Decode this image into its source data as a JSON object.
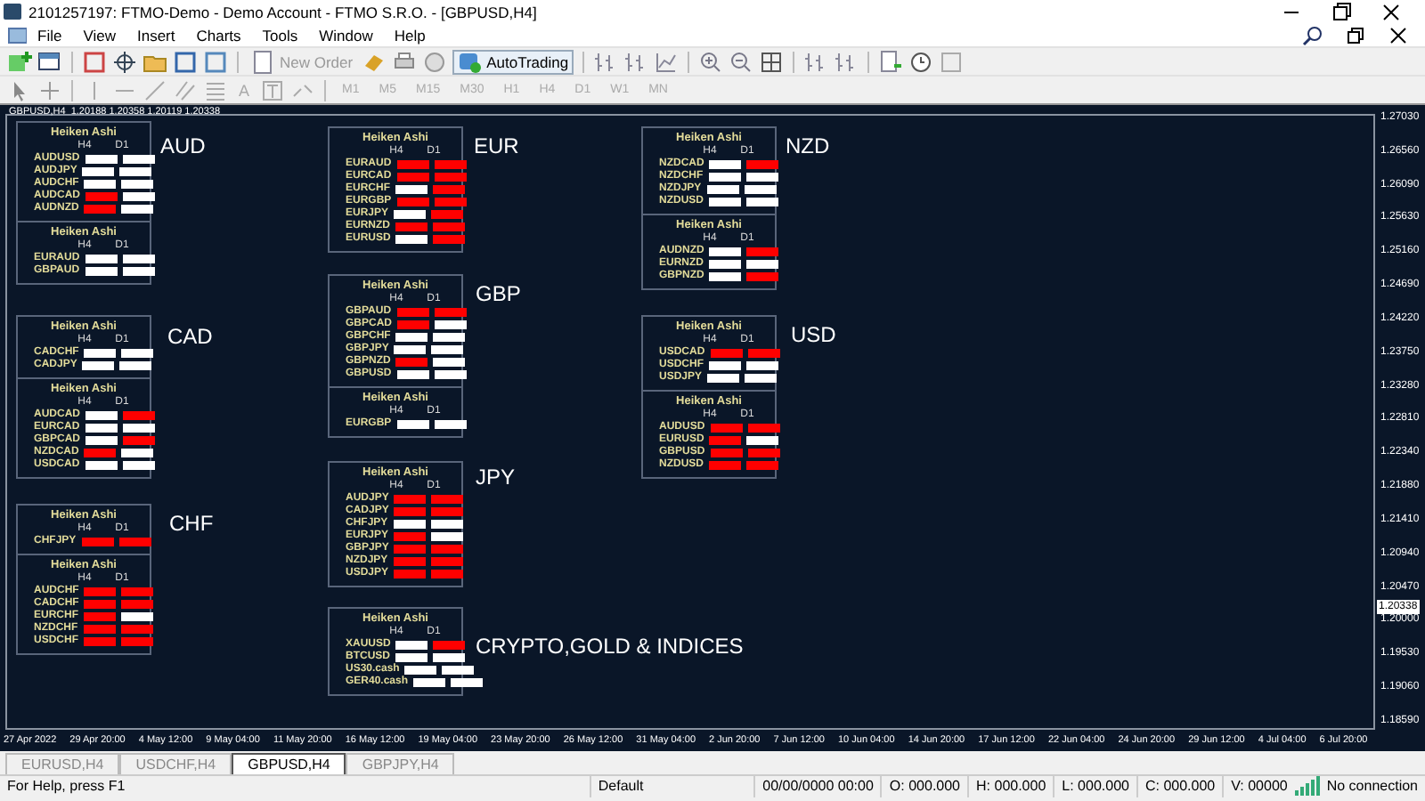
{
  "window": {
    "title": "2101257197: FTMO-Demo - Demo Account - FTMO S.R.O. - [GBPUSD,H4]"
  },
  "menu": [
    "File",
    "View",
    "Insert",
    "Charts",
    "Tools",
    "Window",
    "Help"
  ],
  "toolbar": {
    "new_order": "New Order",
    "auto_trading": "AutoTrading",
    "timeframes": [
      "M1",
      "M5",
      "M15",
      "M30",
      "H1",
      "H4",
      "D1",
      "W1",
      "MN"
    ],
    "text_tool": "A"
  },
  "chart": {
    "header": "GBPUSD,H4  1.20188 1.20358 1.20119 1.20338",
    "groups": [
      {
        "currency": "AUD",
        "panels": [
          {
            "title": "Heiken Ashi",
            "columns": [
              "H4",
              "D1"
            ],
            "rows": [
              {
                "pair": "AUDUSD",
                "h4_down": false,
                "d1_down": false
              },
              {
                "pair": "AUDJPY",
                "h4_down": false,
                "d1_down": false
              },
              {
                "pair": "AUDCHF",
                "h4_down": false,
                "d1_down": false
              },
              {
                "pair": "AUDCAD",
                "h4_down": true,
                "d1_down": false
              },
              {
                "pair": "AUDNZD",
                "h4_down": true,
                "d1_down": false
              }
            ]
          },
          {
            "title": "Heiken Ashi",
            "columns": [
              "H4",
              "D1"
            ],
            "rows": [
              {
                "pair": "EURAUD",
                "h4_down": false,
                "d1_down": false
              },
              {
                "pair": "GBPAUD",
                "h4_down": false,
                "d1_down": false
              }
            ]
          }
        ]
      },
      {
        "currency": "CAD",
        "panels": [
          {
            "title": "Heiken Ashi",
            "columns": [
              "H4",
              "D1"
            ],
            "rows": [
              {
                "pair": "CADCHF",
                "h4_down": false,
                "d1_down": false
              },
              {
                "pair": "CADJPY",
                "h4_down": false,
                "d1_down": false
              }
            ]
          },
          {
            "title": "Heiken Ashi",
            "columns": [
              "H4",
              "D1"
            ],
            "rows": [
              {
                "pair": "AUDCAD",
                "h4_down": false,
                "d1_down": true
              },
              {
                "pair": "EURCAD",
                "h4_down": false,
                "d1_down": false
              },
              {
                "pair": "GBPCAD",
                "h4_down": false,
                "d1_down": true
              },
              {
                "pair": "NZDCAD",
                "h4_down": true,
                "d1_down": false
              },
              {
                "pair": "USDCAD",
                "h4_down": false,
                "d1_down": false
              }
            ]
          }
        ]
      },
      {
        "currency": "CHF",
        "panels": [
          {
            "title": "Heiken Ashi",
            "columns": [
              "H4",
              "D1"
            ],
            "rows": [
              {
                "pair": "CHFJPY",
                "h4_down": true,
                "d1_down": true
              }
            ]
          },
          {
            "title": "Heiken Ashi",
            "columns": [
              "H4",
              "D1"
            ],
            "rows": [
              {
                "pair": "AUDCHF",
                "h4_down": true,
                "d1_down": true
              },
              {
                "pair": "CADCHF",
                "h4_down": true,
                "d1_down": true
              },
              {
                "pair": "EURCHF",
                "h4_down": true,
                "d1_down": false
              },
              {
                "pair": "NZDCHF",
                "h4_down": true,
                "d1_down": true
              },
              {
                "pair": "USDCHF",
                "h4_down": true,
                "d1_down": true
              }
            ]
          }
        ]
      },
      {
        "currency": "EUR",
        "panels": [
          {
            "title": "Heiken Ashi",
            "columns": [
              "H4",
              "D1"
            ],
            "rows": [
              {
                "pair": "EURAUD",
                "h4_down": true,
                "d1_down": true
              },
              {
                "pair": "EURCAD",
                "h4_down": true,
                "d1_down": true
              },
              {
                "pair": "EURCHF",
                "h4_down": false,
                "d1_down": true
              },
              {
                "pair": "EURGBP",
                "h4_down": true,
                "d1_down": true
              },
              {
                "pair": "EURJPY",
                "h4_down": false,
                "d1_down": true
              },
              {
                "pair": "EURNZD",
                "h4_down": true,
                "d1_down": true
              },
              {
                "pair": "EURUSD",
                "h4_down": false,
                "d1_down": true
              }
            ]
          }
        ]
      },
      {
        "currency": "GBP",
        "panels": [
          {
            "title": "Heiken Ashi",
            "columns": [
              "H4",
              "D1"
            ],
            "rows": [
              {
                "pair": "GBPAUD",
                "h4_down": true,
                "d1_down": true
              },
              {
                "pair": "GBPCAD",
                "h4_down": true,
                "d1_down": false
              },
              {
                "pair": "GBPCHF",
                "h4_down": false,
                "d1_down": false
              },
              {
                "pair": "GBPJPY",
                "h4_down": false,
                "d1_down": false
              },
              {
                "pair": "GBPNZD",
                "h4_down": true,
                "d1_down": false
              },
              {
                "pair": "GBPUSD",
                "h4_down": false,
                "d1_down": false
              }
            ]
          },
          {
            "title": "Heiken Ashi",
            "columns": [
              "H4",
              "D1"
            ],
            "rows": [
              {
                "pair": "EURGBP",
                "h4_down": false,
                "d1_down": false
              }
            ]
          }
        ]
      },
      {
        "currency": "JPY",
        "panels": [
          {
            "title": "Heiken Ashi",
            "columns": [
              "H4",
              "D1"
            ],
            "rows": [
              {
                "pair": "AUDJPY",
                "h4_down": true,
                "d1_down": true
              },
              {
                "pair": "CADJPY",
                "h4_down": true,
                "d1_down": true
              },
              {
                "pair": "CHFJPY",
                "h4_down": false,
                "d1_down": false
              },
              {
                "pair": "EURJPY",
                "h4_down": true,
                "d1_down": false
              },
              {
                "pair": "GBPJPY",
                "h4_down": true,
                "d1_down": true
              },
              {
                "pair": "NZDJPY",
                "h4_down": true,
                "d1_down": true
              },
              {
                "pair": "USDJPY",
                "h4_down": true,
                "d1_down": true
              }
            ]
          }
        ]
      },
      {
        "currency": "CRYPTO,GOLD & INDICES",
        "panels": [
          {
            "title": "Heiken Ashi",
            "columns": [
              "H4",
              "D1"
            ],
            "rows": [
              {
                "pair": "XAUUSD",
                "h4_down": false,
                "d1_down": true
              },
              {
                "pair": "BTCUSD",
                "h4_down": false,
                "d1_down": false
              },
              {
                "pair": "US30.cash",
                "h4_down": false,
                "d1_down": false
              },
              {
                "pair": "GER40.cash",
                "h4_down": false,
                "d1_down": false
              }
            ]
          }
        ]
      },
      {
        "currency": "NZD",
        "panels": [
          {
            "title": "Heiken Ashi",
            "columns": [
              "H4",
              "D1"
            ],
            "rows": [
              {
                "pair": "NZDCAD",
                "h4_down": false,
                "d1_down": true
              },
              {
                "pair": "NZDCHF",
                "h4_down": false,
                "d1_down": false
              },
              {
                "pair": "NZDJPY",
                "h4_down": false,
                "d1_down": false
              },
              {
                "pair": "NZDUSD",
                "h4_down": false,
                "d1_down": false
              }
            ]
          },
          {
            "title": "Heiken Ashi",
            "columns": [
              "H4",
              "D1"
            ],
            "rows": [
              {
                "pair": "AUDNZD",
                "h4_down": false,
                "d1_down": true
              },
              {
                "pair": "EURNZD",
                "h4_down": false,
                "d1_down": false
              },
              {
                "pair": "GBPNZD",
                "h4_down": false,
                "d1_down": true
              }
            ]
          }
        ]
      },
      {
        "currency": "USD",
        "panels": [
          {
            "title": "Heiken Ashi",
            "columns": [
              "H4",
              "D1"
            ],
            "rows": [
              {
                "pair": "USDCAD",
                "h4_down": true,
                "d1_down": true
              },
              {
                "pair": "USDCHF",
                "h4_down": false,
                "d1_down": false
              },
              {
                "pair": "USDJPY",
                "h4_down": false,
                "d1_down": false
              }
            ]
          },
          {
            "title": "Heiken Ashi",
            "columns": [
              "H4",
              "D1"
            ],
            "rows": [
              {
                "pair": "AUDUSD",
                "h4_down": true,
                "d1_down": true
              },
              {
                "pair": "EURUSD",
                "h4_down": true,
                "d1_down": false
              },
              {
                "pair": "GBPUSD",
                "h4_down": true,
                "d1_down": true
              },
              {
                "pair": "NZDUSD",
                "h4_down": true,
                "d1_down": true
              }
            ]
          }
        ]
      }
    ],
    "price_axis": [
      "1.27030",
      "1.26560",
      "1.26090",
      "1.25630",
      "1.25160",
      "1.24690",
      "1.24220",
      "1.23750",
      "1.23280",
      "1.22810",
      "1.22340",
      "1.21880",
      "1.21410",
      "1.20940",
      "1.20470",
      "1.20000",
      "1.19530",
      "1.19060",
      "1.18590"
    ],
    "current_price": "1.20338",
    "time_axis": [
      "27 Apr 2022",
      "29 Apr 20:00",
      "4 May 12:00",
      "9 May 04:00",
      "11 May 20:00",
      "16 May 12:00",
      "19 May 04:00",
      "23 May 20:00",
      "26 May 12:00",
      "31 May 04:00",
      "2 Jun 20:00",
      "7 Jun 12:00",
      "10 Jun 04:00",
      "14 Jun 20:00",
      "17 Jun 12:00",
      "22 Jun 04:00",
      "24 Jun 20:00",
      "29 Jun 12:00",
      "4 Jul 04:00",
      "6 Jul 20:00"
    ]
  },
  "tabs": [
    {
      "label": "EURUSD,H4",
      "selected": false
    },
    {
      "label": "USDCHF,H4",
      "selected": false
    },
    {
      "label": "GBPUSD,H4",
      "selected": true
    },
    {
      "label": "GBPJPY,H4",
      "selected": false
    }
  ],
  "status_bar": {
    "help": "For Help, press F1",
    "profile": "Default",
    "datetime": "00/00/0000 00:00",
    "open": "O: 000.000",
    "high": "H: 000.000",
    "low": "L: 000.000",
    "close": "C: 000.000",
    "volume": "V: 00000",
    "connection": "No connection"
  }
}
